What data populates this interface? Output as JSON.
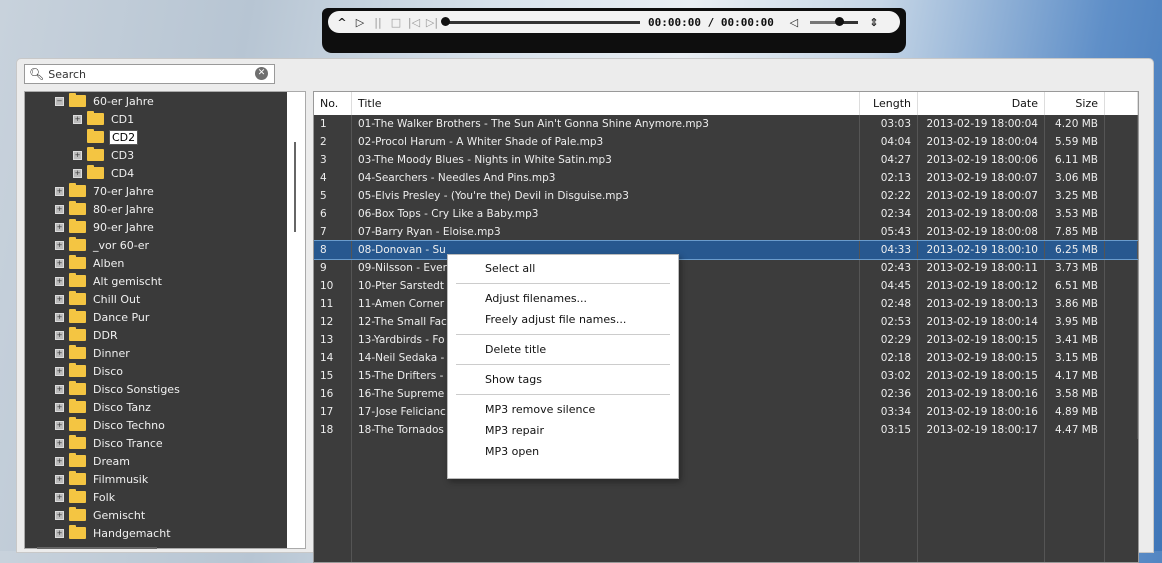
{
  "player": {
    "time": "00:00:00 / 00:00:00",
    "progress": 0,
    "volume": 0.6,
    "buttons": [
      "collapse-icon",
      "play-icon",
      "pause-icon",
      "stop-icon",
      "previous-icon",
      "next-icon",
      "volume-icon",
      "expand-icon"
    ]
  },
  "search": {
    "placeholder": "Search"
  },
  "tree": {
    "items": [
      {
        "label": "60-er Jahre",
        "level": 0,
        "expanded": true
      },
      {
        "label": "CD1",
        "level": 1,
        "expanded": false
      },
      {
        "label": "CD2",
        "level": 1,
        "selected": true,
        "leaf": true
      },
      {
        "label": "CD3",
        "level": 1,
        "expanded": false
      },
      {
        "label": "CD4",
        "level": 1,
        "expanded": false
      },
      {
        "label": "70-er Jahre",
        "level": 0
      },
      {
        "label": "80-er Jahre",
        "level": 0
      },
      {
        "label": "90-er Jahre",
        "level": 0
      },
      {
        "label": "_vor 60-er",
        "level": 0
      },
      {
        "label": "Alben",
        "level": 0
      },
      {
        "label": "Alt gemischt",
        "level": 0
      },
      {
        "label": "Chill Out",
        "level": 0
      },
      {
        "label": "Dance Pur",
        "level": 0
      },
      {
        "label": "DDR",
        "level": 0
      },
      {
        "label": "Dinner",
        "level": 0
      },
      {
        "label": "Disco",
        "level": 0
      },
      {
        "label": "Disco Sonstiges",
        "level": 0
      },
      {
        "label": "Disco Tanz",
        "level": 0
      },
      {
        "label": "Disco Techno",
        "level": 0
      },
      {
        "label": "Disco Trance",
        "level": 0
      },
      {
        "label": "Dream",
        "level": 0
      },
      {
        "label": "Filmmusik",
        "level": 0
      },
      {
        "label": "Folk",
        "level": 0
      },
      {
        "label": "Gemischt",
        "level": 0
      },
      {
        "label": "Handgemacht",
        "level": 0
      }
    ]
  },
  "table": {
    "headers": {
      "no": "No.",
      "title": "Title",
      "length": "Length",
      "date": "Date",
      "size": "Size"
    },
    "rows": [
      {
        "no": "1",
        "title": "01-The Walker Brothers - The Sun Ain't Gonna Shine Anymore.mp3",
        "length": "03:03",
        "date": "2013-02-19  18:00:04",
        "size": "4.20 MB"
      },
      {
        "no": "2",
        "title": "02-Procol Harum - A Whiter Shade of Pale.mp3",
        "length": "04:04",
        "date": "2013-02-19  18:00:04",
        "size": "5.59 MB"
      },
      {
        "no": "3",
        "title": "03-The Moody Blues - Nights in White Satin.mp3",
        "length": "04:27",
        "date": "2013-02-19  18:00:06",
        "size": "6.11 MB"
      },
      {
        "no": "4",
        "title": "04-Searchers - Needles And Pins.mp3",
        "length": "02:13",
        "date": "2013-02-19  18:00:07",
        "size": "3.06 MB"
      },
      {
        "no": "5",
        "title": "05-Elvis Presley - (You're the) Devil in Disguise.mp3",
        "length": "02:22",
        "date": "2013-02-19  18:00:07",
        "size": "3.25 MB"
      },
      {
        "no": "6",
        "title": "06-Box Tops - Cry Like a Baby.mp3",
        "length": "02:34",
        "date": "2013-02-19  18:00:08",
        "size": "3.53 MB"
      },
      {
        "no": "7",
        "title": "07-Barry Ryan - Eloise.mp3",
        "length": "05:43",
        "date": "2013-02-19  18:00:08",
        "size": "7.85 MB"
      },
      {
        "no": "8",
        "title": "08-Donovan - Su",
        "length": "04:33",
        "date": "2013-02-19  18:00:10",
        "size": "6.25 MB",
        "selected": true
      },
      {
        "no": "9",
        "title": "09-Nilsson - Ever",
        "length": "02:43",
        "date": "2013-02-19  18:00:11",
        "size": "3.73 MB"
      },
      {
        "no": "10",
        "title": "10-Pter Sarstedt",
        "length": "04:45",
        "date": "2013-02-19  18:00:12",
        "size": "6.51 MB"
      },
      {
        "no": "11",
        "title": "11-Amen Corner",
        "length": "02:48",
        "date": "2013-02-19  18:00:13",
        "size": "3.86 MB"
      },
      {
        "no": "12",
        "title": "12-The Small Fac",
        "length": "02:53",
        "date": "2013-02-19  18:00:14",
        "size": "3.95 MB"
      },
      {
        "no": "13",
        "title": "13-Yardbirds - Fo",
        "length": "02:29",
        "date": "2013-02-19  18:00:15",
        "size": "3.41 MB"
      },
      {
        "no": "14",
        "title": "14-Neil Sedaka -",
        "length": "02:18",
        "date": "2013-02-19  18:00:15",
        "size": "3.15 MB"
      },
      {
        "no": "15",
        "title": "15-The Drifters -",
        "length": "03:02",
        "date": "2013-02-19  18:00:15",
        "size": "4.17 MB"
      },
      {
        "no": "16",
        "title": "16-The Supreme",
        "length": "02:36",
        "date": "2013-02-19  18:00:16",
        "size": "3.58 MB"
      },
      {
        "no": "17",
        "title": "17-Jose Felicianc",
        "length": "03:34",
        "date": "2013-02-19  18:00:16",
        "size": "4.89 MB"
      },
      {
        "no": "18",
        "title": "18-The Tornados",
        "length": "03:15",
        "date": "2013-02-19  18:00:17",
        "size": "4.47 MB"
      }
    ]
  },
  "context_menu": {
    "groups": [
      [
        "Select all"
      ],
      [
        "Adjust filenames...",
        "Freely adjust file names..."
      ],
      [
        "Delete title"
      ],
      [
        "Show tags"
      ],
      [
        "MP3 remove silence",
        "MP3 repair",
        "MP3 open"
      ]
    ]
  }
}
